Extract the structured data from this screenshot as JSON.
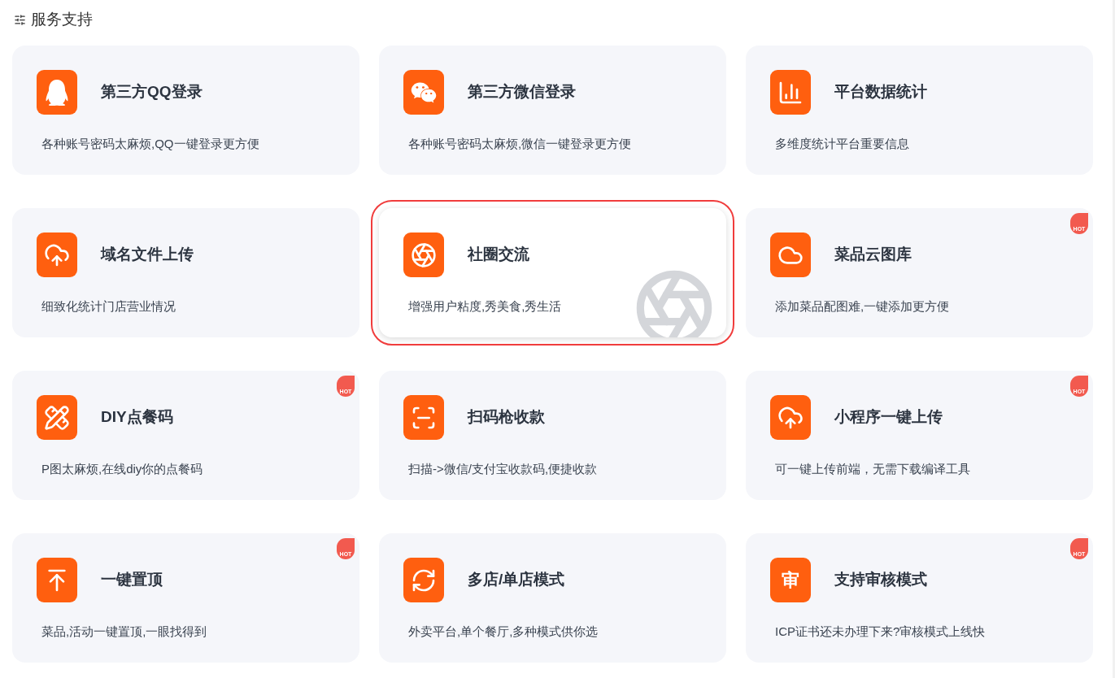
{
  "header": {
    "title": "服务支持"
  },
  "cards": [
    {
      "title": "第三方QQ登录",
      "description": "各种账号密码太麻烦,QQ一键登录更方便",
      "selected": false
    },
    {
      "title": "第三方微信登录",
      "description": "各种账号密码太麻烦,微信一键登录更方便",
      "selected": false
    },
    {
      "title": "平台数据统计",
      "description": "多维度统计平台重要信息",
      "selected": false
    },
    {
      "title": "域名文件上传",
      "description": "细致化统计门店营业情况",
      "selected": false
    },
    {
      "title": "社圈交流",
      "description": "增强用户粘度,秀美食,秀生活",
      "selected": true
    },
    {
      "title": "菜品云图库",
      "description": "添加菜品配图难,一键添加更方便",
      "selected": false,
      "badge": "HOT"
    },
    {
      "title": "DIY点餐码",
      "description": "P图太麻烦,在线diy你的点餐码",
      "selected": false,
      "badge": "HOT"
    },
    {
      "title": "扫码枪收款",
      "description": "扫描->微信/支付宝收款码,便捷收款",
      "selected": false
    },
    {
      "title": "小程序一键上传",
      "description": "可一键上传前端，无需下载编译工具",
      "selected": false,
      "badge": "HOT"
    },
    {
      "title": "一键置顶",
      "description": "菜品,活动一键置顶,一眼找得到",
      "selected": false,
      "badge": "HOT"
    },
    {
      "title": "多店/单店模式",
      "description": "外卖平台,单个餐厅,多种模式供你选",
      "selected": false
    },
    {
      "title": "支持审核模式",
      "description": "ICP证书还未办理下来?审核模式上线快",
      "selected": false,
      "badge": "HOT",
      "icon_text": "审"
    }
  ]
}
